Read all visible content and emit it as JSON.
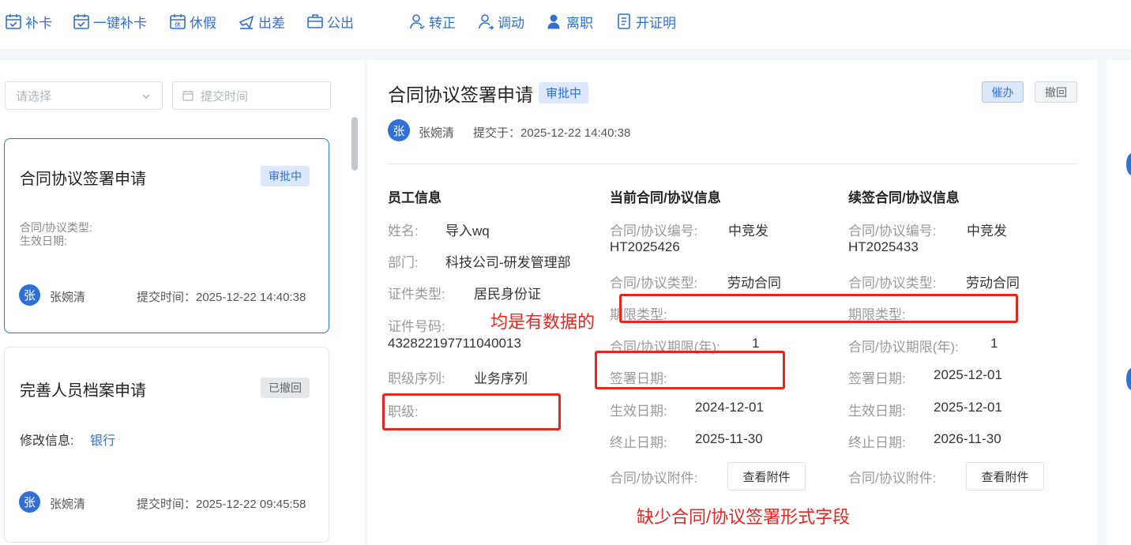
{
  "toolbar": {
    "items": [
      {
        "label": "补卡",
        "icon": "calendar-check-icon"
      },
      {
        "label": "一键补卡",
        "icon": "calendar-check-icon"
      },
      {
        "label": "休假",
        "icon": "calendar-leave-icon"
      },
      {
        "label": "出差",
        "icon": "plane-icon"
      },
      {
        "label": "公出",
        "icon": "briefcase-icon"
      },
      {
        "label": "转正",
        "icon": "user-check-icon"
      },
      {
        "label": "调动",
        "icon": "user-transfer-icon"
      },
      {
        "label": "离职",
        "icon": "user-leave-icon"
      },
      {
        "label": "开证明",
        "icon": "document-icon"
      }
    ]
  },
  "filters": {
    "select_placeholder": "请选择",
    "date_placeholder": "提交时间"
  },
  "list": {
    "cards": [
      {
        "title": "合同协议签署申请",
        "status": "审批中",
        "field1": "合同/协议类型:",
        "field2": "生效日期:",
        "avatar": "张",
        "user": "张婉清",
        "submit_time": "提交时间：2025-12-22 14:40:38"
      },
      {
        "title": "完善人员档案申请",
        "status": "已撤回",
        "field_label": "修改信息:",
        "field_value": "银行",
        "avatar": "张",
        "user": "张婉清",
        "submit_time": "提交时间：2025-12-22 09:45:58"
      }
    ]
  },
  "detail": {
    "title": "合同协议签署申请",
    "status": "审批中",
    "urge_label": "催办",
    "withdraw_label": "撤回",
    "avatar": "张",
    "user": "张婉清",
    "submitted": "提交于：2025-12-22 14:40:38",
    "employee": {
      "heading": "员工信息",
      "name_label": "姓名:",
      "name": "导入wq",
      "dept_label": "部门:",
      "dept": "科技公司-研发管理部",
      "idtype_label": "证件类型:",
      "idtype": "居民身份证",
      "idno_label": "证件号码:",
      "idno": "432822197711040013",
      "seq_label": "职级序列:",
      "seq": "业务序列",
      "rank_label": "职级:"
    },
    "current": {
      "heading": "当前合同/协议信息",
      "no_label": "合同/协议编号:",
      "no_1": "中竞发",
      "no_2": "HT2025426",
      "type_label": "合同/协议类型:",
      "type": "劳动合同",
      "term_type_label": "期限类型:",
      "term_label": "合同/协议期限(年):",
      "term": "1",
      "sign_label": "签署日期:",
      "effective_label": "生效日期:",
      "effective": "2024-12-01",
      "end_label": "终止日期:",
      "end": "2025-11-30",
      "attach_label": "合同/协议附件:",
      "attach_btn": "查看附件"
    },
    "renewal": {
      "heading": "续签合同/协议信息",
      "no_label": "合同/协议编号:",
      "no_1": "中竞发",
      "no_2": "HT2025433",
      "type_label": "合同/协议类型:",
      "type": "劳动合同",
      "term_type_label": "期限类型:",
      "term_label": "合同/协议期限(年):",
      "term": "1",
      "sign_label": "签署日期:",
      "sign": "2025-12-01",
      "effective_label": "生效日期:",
      "effective": "2025-12-01",
      "end_label": "终止日期:",
      "end": "2026-11-30",
      "attach_label": "合同/协议附件:",
      "attach_btn": "查看附件"
    }
  },
  "annotations": {
    "note1": "均是有数据的",
    "note2": "缺少合同/协议签署形式字段",
    "color": "#e6261f"
  },
  "colors": {
    "accent": "#2f6fd6",
    "status_pending_bg": "#dce8fb",
    "status_withdrawn_bg": "#e6e7e9"
  }
}
